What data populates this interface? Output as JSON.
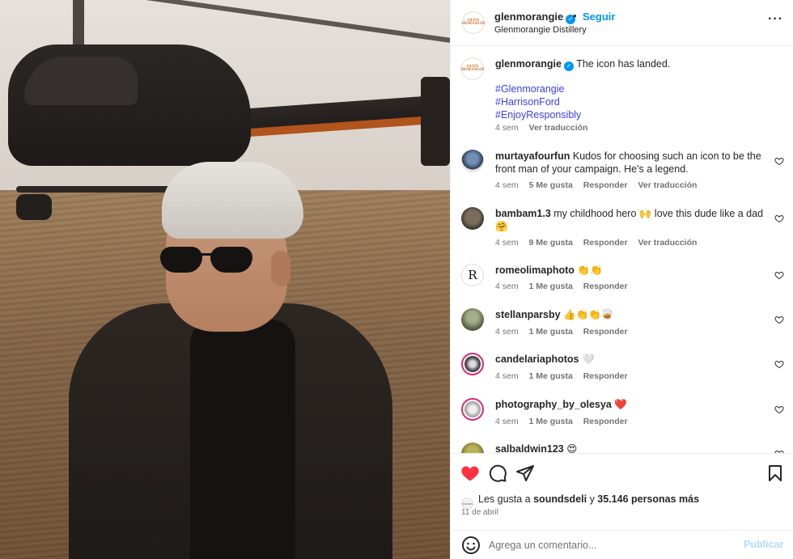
{
  "post": {
    "account": "glenmorangie",
    "follow_label": "Seguir",
    "dot": "•",
    "location": "Glenmorangie Distillery",
    "logo_text": "GLEN MORANGIE",
    "caption": "The icon has landed.",
    "hashtags": [
      "#Glenmorangie",
      "#HarrisonFord",
      "#EnjoyResponsibly"
    ],
    "caption_age": "4 sem",
    "translate_label": "Ver traducción"
  },
  "comments": [
    {
      "user": "murtayafourfun",
      "text": "Kudos for choosing such an icon to be the front man of your campaign. He's a legend.",
      "age": "4 sem",
      "likes": "5 Me gusta",
      "reply": "Responder",
      "translate": "Ver traducción"
    },
    {
      "user": "bambam1.3",
      "text": "my childhood hero 🙌 love this dude like a dad 🤗",
      "age": "4 sem",
      "likes": "9 Me gusta",
      "reply": "Responder",
      "translate": "Ver traducción"
    },
    {
      "user": "romeolimaphoto",
      "text": "👏👏",
      "age": "4 sem",
      "likes": "1 Me gusta",
      "reply": "Responder",
      "avatar_letter": "R"
    },
    {
      "user": "stellanparsby",
      "text": "👍👏👏🥃",
      "age": "4 sem",
      "likes": "1 Me gusta",
      "reply": "Responder"
    },
    {
      "user": "candelariaphotos",
      "text": "🤍",
      "age": "4 sem",
      "likes": "1 Me gusta",
      "reply": "Responder"
    },
    {
      "user": "photography_by_olesya",
      "text": "❤️",
      "age": "4 sem",
      "likes": "1 Me gusta",
      "reply": "Responder"
    },
    {
      "user": "salbaldwin123",
      "text": "😍"
    }
  ],
  "likes_summary": {
    "prefix": "Les gusta a ",
    "user": "soundsdeli",
    "middle": " y ",
    "count": "35.146 personas más",
    "mini_avatar": "SOUNDS"
  },
  "date": "11 de abril",
  "composer": {
    "placeholder": "Agrega un comentario...",
    "publish_label": "Publicar"
  },
  "colors": {
    "accent": "#0095f6",
    "hashtag": "#3c3ff0",
    "liked_heart": "#ff3040",
    "muted": "#737373"
  },
  "icons": {
    "verified": "verified-badge-icon",
    "more": "more-options-icon",
    "heart": "heart-icon",
    "comment": "comment-icon",
    "share": "share-icon",
    "save": "bookmark-icon",
    "emoji": "emoji-icon"
  }
}
